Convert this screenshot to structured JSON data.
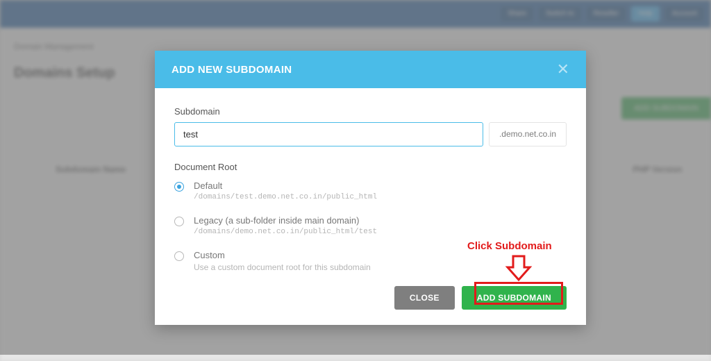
{
  "bg": {
    "crumb": "Domain Management",
    "title": "Domains Setup",
    "addbtn": "ADD SUBDOMAIN",
    "col1": "Subdomain Name",
    "col2": "PHP Version"
  },
  "modal": {
    "title": "ADD NEW SUBDOMAIN",
    "subdomain_label": "Subdomain",
    "subdomain_value": "test",
    "suffix": ".demo.net.co.in",
    "docroot_label": "Document Root",
    "options": {
      "default": {
        "title": "Default",
        "sub": "/domains/test.demo.net.co.in/public_html"
      },
      "legacy": {
        "title": "Legacy (a sub-folder inside main domain)",
        "sub": "/domains/demo.net.co.in/public_html/test"
      },
      "custom": {
        "title": "Custom",
        "sub": "Use a custom document root for this subdomain"
      }
    },
    "close": "CLOSE",
    "add": "ADD SUBDOMAIN"
  },
  "annotation": {
    "text": "Click Subdomain"
  }
}
